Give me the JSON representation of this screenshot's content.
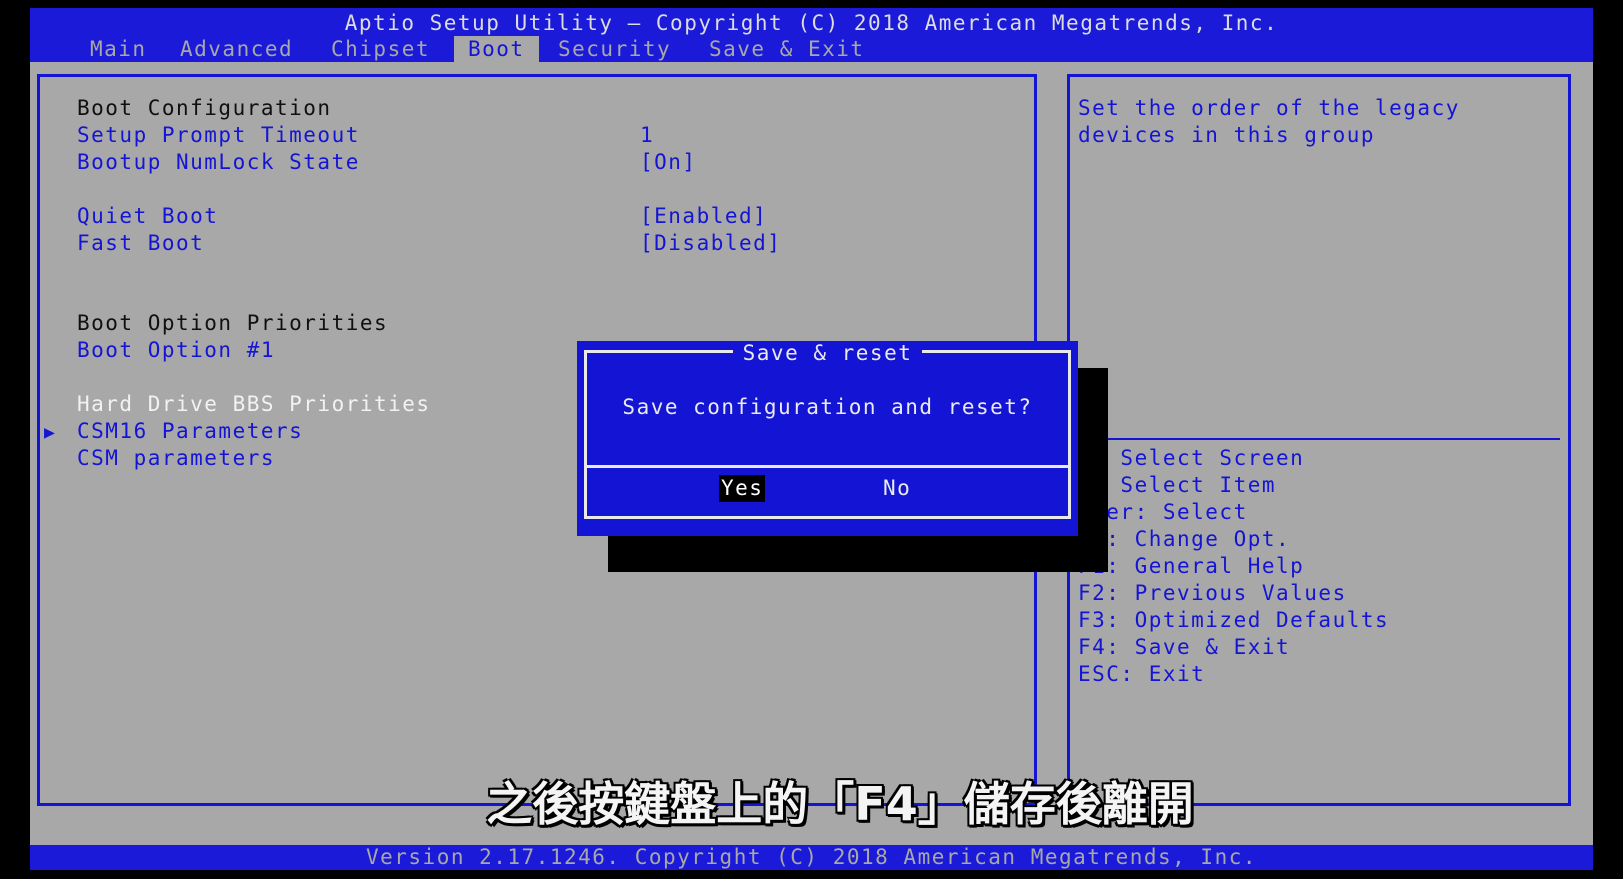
{
  "window": {
    "title": "Aptio Setup Utility – Copyright (C) 2018 American Megatrends, Inc."
  },
  "tabs": [
    {
      "label": "Main"
    },
    {
      "label": "Advanced"
    },
    {
      "label": "Chipset"
    },
    {
      "label": "Boot",
      "active": true
    },
    {
      "label": "Security"
    },
    {
      "label": "Save & Exit"
    }
  ],
  "main": {
    "boot_configuration_header": "Boot Configuration",
    "setup_prompt_timeout": {
      "label": "Setup Prompt Timeout",
      "value": "1"
    },
    "bootup_numlock_state": {
      "label": "Bootup NumLock State",
      "value": "[On]"
    },
    "quiet_boot": {
      "label": "Quiet Boot",
      "value": "[Enabled]"
    },
    "fast_boot": {
      "label": "Fast Boot",
      "value": "[Disabled]"
    },
    "boot_option_priorities_header": "Boot Option Priorities",
    "boot_option_1": {
      "label": "Boot Option #1"
    },
    "hard_drive_bbs_priorities": "Hard Drive BBS Priorities",
    "csm16_parameters": "CSM16 Parameters",
    "csm_parameters": "CSM parameters",
    "caret": "▶"
  },
  "help": {
    "description_line1": "Set the order of the legacy",
    "description_line2": "devices in this group",
    "keys": [
      "←: Select Screen",
      "↓: Select Item",
      "nter: Select",
      "/-: Change Opt.",
      "F1: General Help",
      "F2: Previous Values",
      "F3: Optimized Defaults",
      "F4: Save & Exit",
      "ESC: Exit"
    ]
  },
  "dialog": {
    "title": "Save & reset",
    "message": "Save configuration and reset?",
    "yes_label": "Yes",
    "no_label": "No"
  },
  "footer": {
    "text": "Version 2.17.1246. Copyright (C) 2018 American Megatrends, Inc."
  },
  "subtitle": "之後按鍵盤上的「F4」儲存後離開",
  "colors": {
    "bios_blue": "#1414d4",
    "panel_gray": "#a8a8a8",
    "highlight_white": "#f2f2f2"
  }
}
